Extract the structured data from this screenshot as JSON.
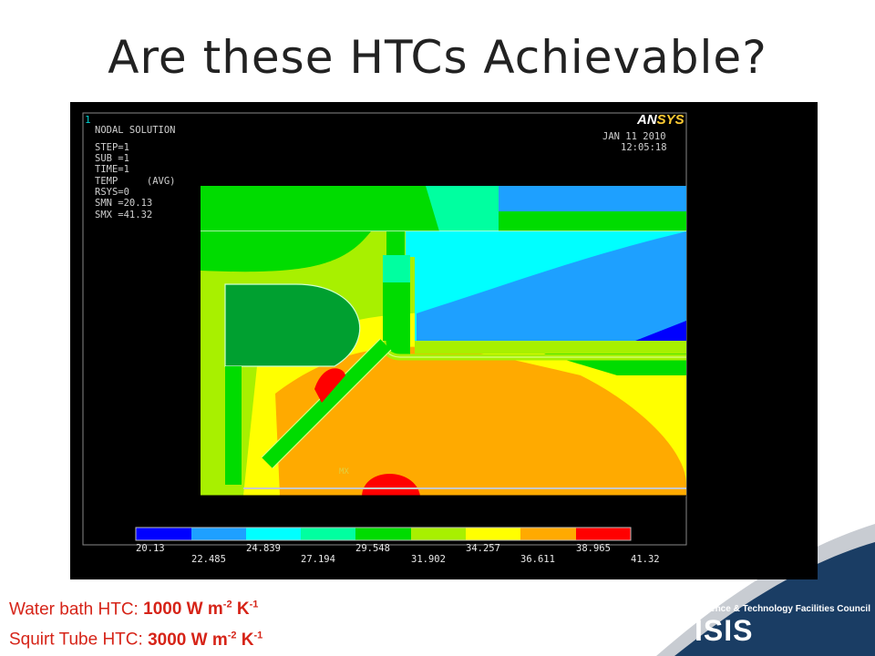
{
  "slide": {
    "title": "Are these HTCs Achievable?"
  },
  "ansys": {
    "window_number": "1",
    "solution_type": "NODAL SOLUTION",
    "params": [
      "STEP=1",
      "SUB =1",
      "TIME=1",
      "TEMP     (AVG)",
      "RSYS=0",
      "SMN =20.13",
      "SMX =41.32"
    ],
    "logo": {
      "part_a": "AN",
      "part_b": "SYS",
      "color_a": "#ffffff",
      "color_b": "#ffcc33"
    },
    "date": "JAN 11 2010",
    "time": "12:05:18",
    "max_marker": "MX",
    "colormap": [
      "#0000ff",
      "#1ea0ff",
      "#00ffff",
      "#00ffa0",
      "#00dc00",
      "#a8f000",
      "#ffff00",
      "#ffaa00",
      "#ff0000"
    ],
    "legend_top": [
      "20.13",
      "24.839",
      "29.548",
      "34.257",
      "38.965"
    ],
    "legend_bottom": [
      "22.485",
      "27.194",
      "31.902",
      "36.611",
      "41.32"
    ]
  },
  "htc": {
    "water_bath_label": "Water bath HTC: ",
    "water_bath_value": "1000 W m",
    "squirt_tube_label": "Squirt Tube HTC: ",
    "squirt_tube_value": "3000 W m",
    "exp_m": "-2",
    "unit_k": " K",
    "exp_k": "-1"
  },
  "branding": {
    "council": "Science & Technology Facilities Council",
    "facility": "ISIS",
    "band_color": "#1a3d64"
  }
}
